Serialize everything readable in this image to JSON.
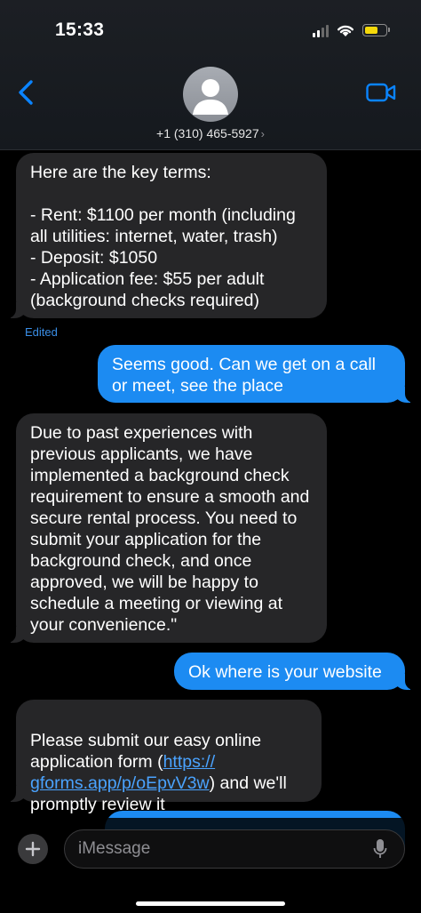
{
  "status": {
    "time": "15:33"
  },
  "contact": {
    "phone": "+1 (310) 465-5927",
    "chevron": "›"
  },
  "messages": [
    {
      "direction": "incoming",
      "text": "Here are the key terms:\n\n- Rent: $1100 per month (including all utilities: internet, water, trash)\n- Deposit: $1050\n- Application fee: $55 per adult (background checks required)"
    },
    {
      "direction": "outgoing",
      "text": "Seems good. Can we get on a call or meet, see the place"
    },
    {
      "direction": "incoming",
      "text": "Due to past experiences with previous applicants, we have implemented a background check requirement to ensure a smooth and secure rental process. You need to submit your application for the background check, and once approved, we will be happy to schedule a meeting or viewing at your convenience.\""
    },
    {
      "direction": "outgoing",
      "text": "Ok where is your website"
    },
    {
      "direction": "incoming",
      "text_before": "Please submit our easy online application form (",
      "link": "https://\ngforms.app/p/oEpvV3w",
      "text_after": ") and we'll promptly review it"
    }
  ],
  "edited_label": "Edited",
  "input": {
    "placeholder": "iMessage"
  },
  "icons": [
    "back-chevron-icon",
    "video-camera-icon",
    "avatar-icon",
    "plus-icon",
    "microphone-icon",
    "signal-icon",
    "wifi-icon",
    "battery-icon"
  ],
  "colors": {
    "outgoing": "#1c8bf2",
    "incoming": "#262628",
    "link": "#4aa3ff",
    "accent": "#0a84ff",
    "battery": "#f5d90a"
  }
}
